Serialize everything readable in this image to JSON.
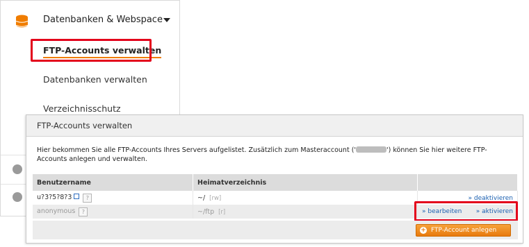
{
  "sidebar": {
    "section_title": "Datenbanken & Webspace",
    "section_icon": "database-icon",
    "items": [
      {
        "label": "FTP-Accounts verwalten",
        "active": true
      },
      {
        "label": "Datenbanken verwalten"
      },
      {
        "label": "Verzeichnisschutz"
      }
    ],
    "colors": {
      "accent": "#f07d00",
      "highlight": "#e3001b"
    }
  },
  "dialog": {
    "title": "FTP-Accounts verwalten",
    "description_before": "Hier bekommen Sie alle FTP-Accounts Ihres Servers aufgelistet. Zusätzlich zum Masteraccount ('",
    "description_after": "') können Sie hier weitere FTP-Accounts anlegen und verwalten.",
    "table": {
      "columns": [
        "Benutzername",
        "Heimatverzeichnis",
        ""
      ],
      "rows": [
        {
          "username": "u?3?5?8?3",
          "help": "?",
          "home": "~/",
          "perm": "[rw]",
          "actions": [
            "» deaktivieren"
          ]
        },
        {
          "username": "anonymous",
          "help": "?",
          "home": "~/ftp",
          "perm": "[r]",
          "actions": [
            "» bearbeiten",
            "» aktivieren"
          ]
        }
      ]
    },
    "add_button": "FTP-Account anlegen",
    "colors": {
      "button": "#e87a0e",
      "link": "#1a5fb0"
    }
  }
}
